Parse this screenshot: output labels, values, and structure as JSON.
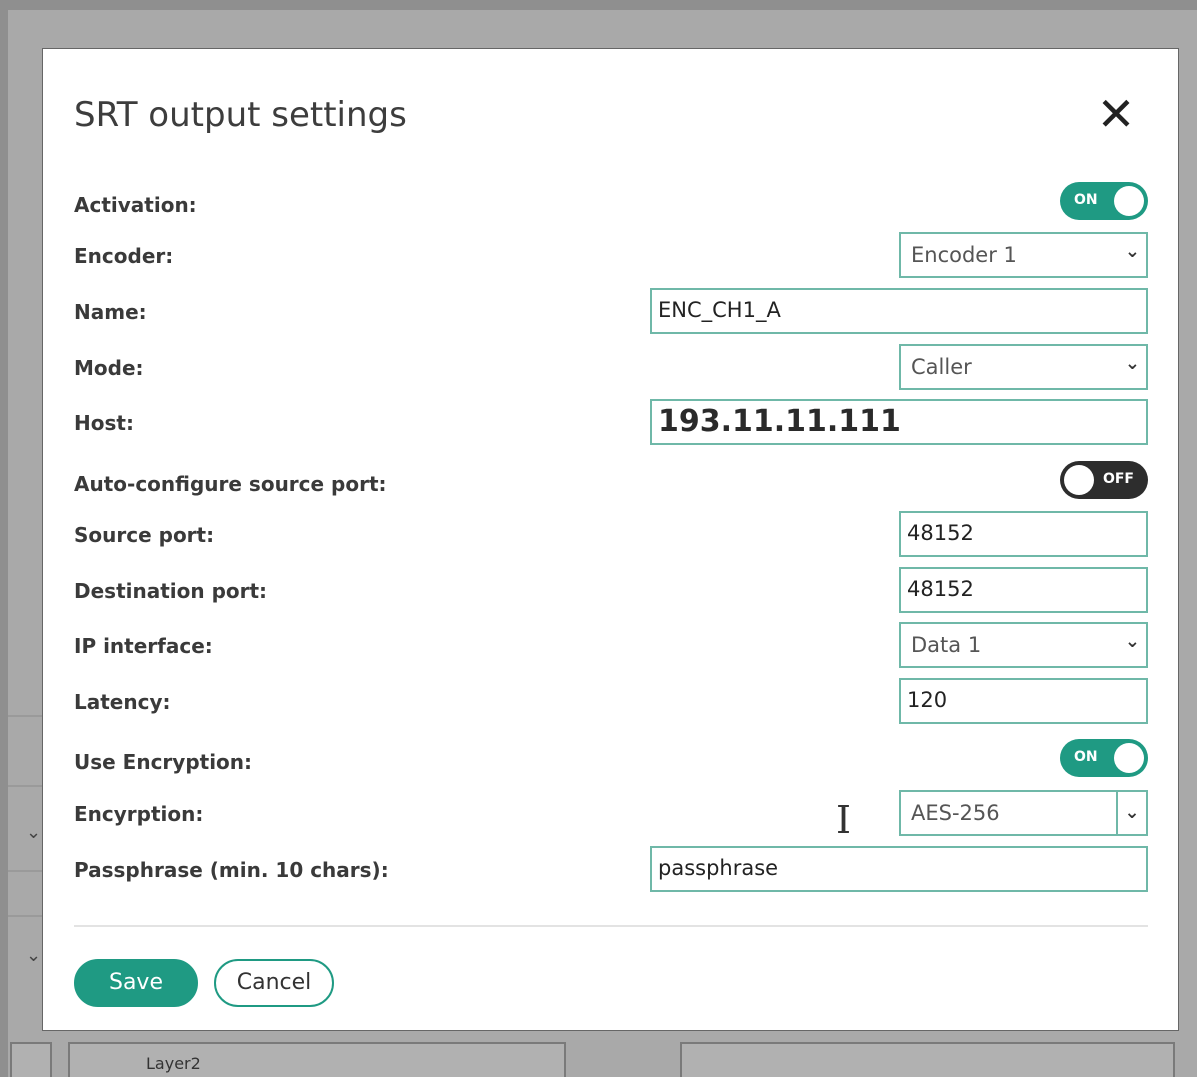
{
  "dialog": {
    "title": "SRT output settings",
    "close_glyph": "✕"
  },
  "fields": {
    "activation": {
      "label": "Activation:",
      "state": "ON"
    },
    "encoder": {
      "label": "Encoder:",
      "value": "Encoder 1"
    },
    "name": {
      "label": "Name:",
      "value": "ENC_CH1_A"
    },
    "mode": {
      "label": "Mode:",
      "value": "Caller"
    },
    "host": {
      "label": "Host:",
      "value": "193.11.11.111"
    },
    "auto_source_port": {
      "label": "Auto-configure source port:",
      "state": "OFF"
    },
    "source_port": {
      "label": "Source port:",
      "value": "48152"
    },
    "destination_port": {
      "label": "Destination port:",
      "value": "48152"
    },
    "ip_interface": {
      "label": "IP interface:",
      "value": "Data 1"
    },
    "latency": {
      "label": "Latency:",
      "value": "120"
    },
    "use_encryption": {
      "label": "Use Encryption:",
      "state": "ON"
    },
    "encryption": {
      "label": "Encyrption:",
      "value": "AES-256"
    },
    "passphrase": {
      "label": "Passphrase (min. 10 chars):",
      "value": "passphrase"
    }
  },
  "buttons": {
    "save": "Save",
    "cancel": "Cancel"
  },
  "background": {
    "layer_label": "Layer2"
  },
  "icons": {
    "chevron": "chevron-down-icon",
    "close": "close-icon",
    "text_cursor": "text-cursor-icon"
  },
  "colors": {
    "accent": "#1f9a83",
    "field_border": "#6fb8a8",
    "toggle_off": "#2d2d2d"
  }
}
